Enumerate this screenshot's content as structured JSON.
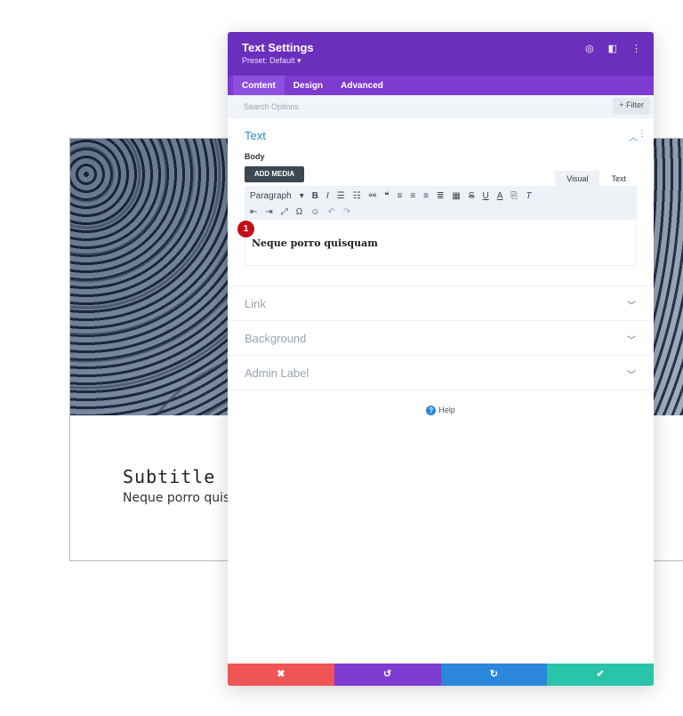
{
  "background": {
    "subtitle": "Subtitle",
    "text": "Neque porro quisc"
  },
  "panel": {
    "title": "Text Settings",
    "preset": "Preset: Default ▾",
    "header_icons": [
      "target-icon",
      "columns-icon",
      "more-icon"
    ],
    "tabs": [
      "Content",
      "Design",
      "Advanced"
    ],
    "search_placeholder": "Search Options",
    "filter_label": "+ Filter",
    "text_section": {
      "title": "Text",
      "body_label": "Body",
      "add_media": "ADD MEDIA",
      "editor_tabs": [
        "Visual",
        "Text"
      ],
      "paragraph_select": "Paragraph",
      "content": "Neque porro quisquam"
    },
    "collapsed_sections": [
      "Link",
      "Background",
      "Admin Label"
    ],
    "help": "Help",
    "badge": "1"
  },
  "colors": {
    "header": "#6c2fbd",
    "tabs": "#7e3bd0",
    "cancel": "#ef5555",
    "undo": "#7e3bd0",
    "redo": "#2b87da",
    "save": "#29c4a9"
  }
}
